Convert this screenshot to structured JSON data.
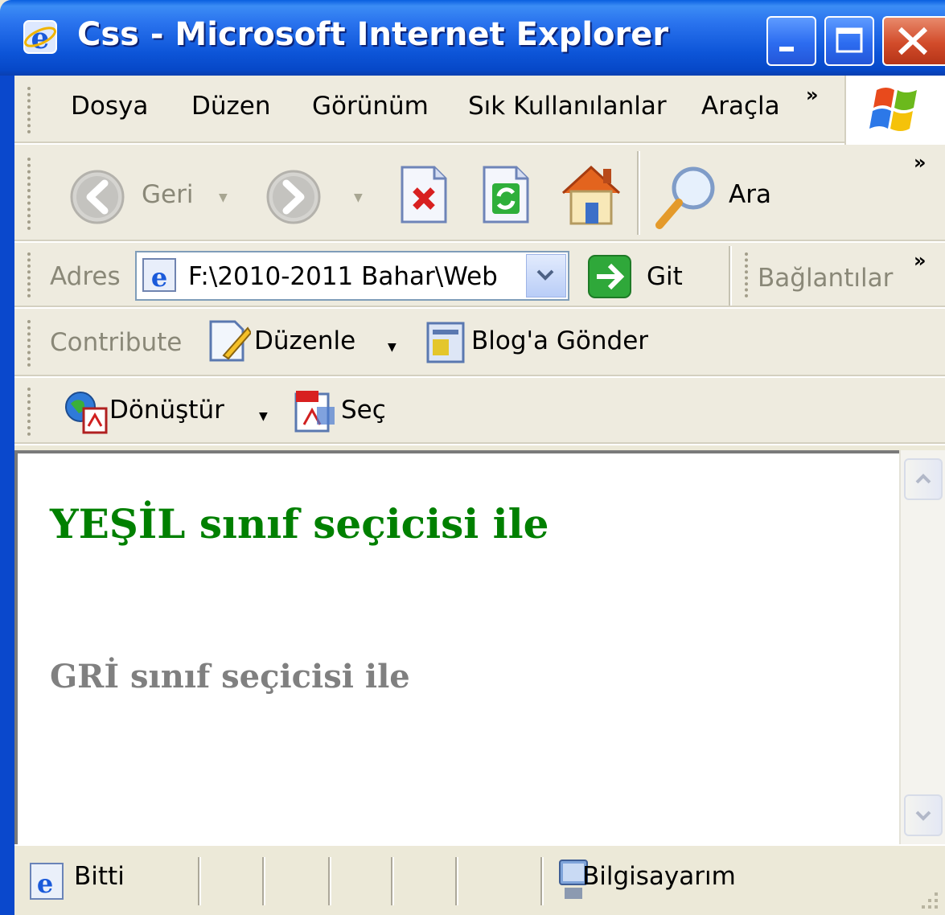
{
  "window": {
    "title": "Css - Microsoft Internet Explorer"
  },
  "menu": {
    "items": [
      "Dosya",
      "Düzen",
      "Görünüm",
      "Sık Kullanılanlar",
      "Araçla"
    ],
    "overflow": "»"
  },
  "toolbar": {
    "back_label": "Geri",
    "search_label": "Ara",
    "overflow": "»"
  },
  "address": {
    "label": "Adres",
    "value": "F:\\2010-2011 Bahar\\Web",
    "go_label": "Git",
    "links_label": "Bağlantılar",
    "overflow": "»"
  },
  "contribute": {
    "label": "Contribute",
    "edit_label": "Düzenle",
    "blog_label": "Blog'a Gönder"
  },
  "pdf": {
    "convert_label": "Dönüştür",
    "select_label": "Seç"
  },
  "page": {
    "green_heading": "YEŞİL sınıf seçicisi ile",
    "gray_heading": "GRİ sınıf seçicisi ile"
  },
  "status": {
    "state": "Bitti",
    "zone": "Bilgisayarım"
  },
  "colors": {
    "titlebar": "#0A55D8",
    "green_text": "#008000",
    "gray_text": "#808080"
  }
}
